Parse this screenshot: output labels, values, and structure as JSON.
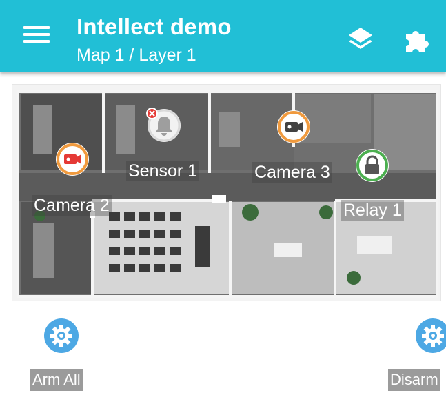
{
  "app": {
    "title": "Intellect demo",
    "subtitle": "Map 1 / Layer 1",
    "menu_icon": "hamburger-menu-icon",
    "layers_icon": "layers-icon",
    "plugin_icon": "puzzle-piece-icon",
    "bar_color": "#21bfd6"
  },
  "map": {
    "objects": [
      {
        "label": "Sensor 1",
        "icon": "bell-icon",
        "status_icon": "error-x-icon",
        "ring_color": "#d9d9d9"
      },
      {
        "label": "Camera 2",
        "icon": "camera-icon",
        "ring_color": "#f09a3e",
        "fill_color": "#e53935"
      },
      {
        "label": "Camera 3",
        "icon": "camera-icon",
        "ring_color": "#f09a3e",
        "fill_color": "#424242"
      },
      {
        "label": "Relay 1",
        "icon": "lock-icon",
        "ring_color": "#4caf50"
      }
    ]
  },
  "actions": [
    {
      "label": "Arm All",
      "icon": "gear-icon",
      "color": "#4da8e4"
    },
    {
      "label": "Disarm",
      "icon": "gear-icon",
      "color": "#4da8e4"
    }
  ]
}
